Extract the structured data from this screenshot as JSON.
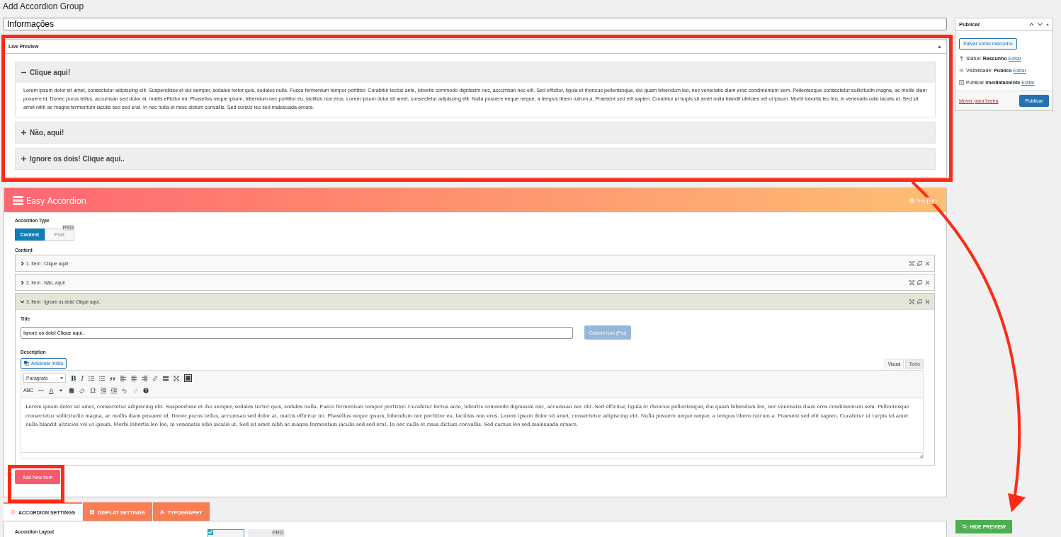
{
  "page_title": "Add Accordion Group",
  "title_field": {
    "value": "Informações"
  },
  "live_preview": {
    "title": "Live Preview",
    "items": [
      {
        "title": "Clique aqui!",
        "expanded": true,
        "body": "Lorem ipsum dolor sit amet, consectetur adipiscing elit. Suspendisse et dui semper, sodales tortor quis, sodales nulla. Fusce fermentum tempor porttitor. Curabitur lectus ante, lobortis commodo dignissim nec, accumsan nec elit. Sed efficitur, ligula et rhoncus pellentesque, dui quam bibendum leo, nec venenatis diam eros condimentum sem. Pellentesque consectetur sollicitudin magna, ac mollis diam posuere id. Donec purus tellus, accumsan sed dolor at, mattis efficitur mi. Phasellus neque ipsum, bibendum nec porttitor eu, facilisis non eros. Lorem ipsum dolor sit amet, consectetur adipiscing elit. Nulla posuere neque neque, a tempus libero rutrum a. Praesent sed elit sapien. Curabitur ut turpis sit amet nulla blandit ultricies vel ut ipsum. Morbi lobortis leo leo, in venenatis odio iaculis ut. Sed sit amet nibh ac magna fermentum iaculis sed sed erat. In nec nulla et risus dictum convallis. Sed cursus leo sed malesuada ornare."
      },
      {
        "title": "Não, aqui!",
        "expanded": false
      },
      {
        "title": "Ignore os dois! Clique aqui..",
        "expanded": false
      }
    ]
  },
  "easy_accordion": {
    "title": "Easy Accordion",
    "support": "Support",
    "type_label": "Accordion Type",
    "type_options": [
      {
        "label": "Content",
        "selected": true
      },
      {
        "label": "Post",
        "selected": false,
        "badge": "PRO"
      }
    ],
    "content_label": "Content",
    "items": [
      {
        "label": "1. Item :  Clique aqui!",
        "expanded": false
      },
      {
        "label": "2. Item :  Não, aqui!",
        "expanded": false
      },
      {
        "label": "3. Item :  Ignore os dois! Clique aqui..",
        "expanded": true
      }
    ],
    "item_form": {
      "title_label": "Title",
      "title_value": "Ignore os dois! Clique aqui..",
      "custom_icon": "Custom Icon (Pro)",
      "description_label": "Description",
      "add_media": "Adicionar mídia",
      "editor_tabs": [
        {
          "label": "Visual",
          "selected": true
        },
        {
          "label": "Texto",
          "selected": false
        }
      ],
      "format_select": "Parágrafo",
      "glyphs": {
        "bold": "B",
        "italic": "I",
        "strike": "ABC",
        "forecolor": "A",
        "omega": "Ω"
      },
      "content": "Lorem ipsum dolor sit amet, consectetur adipiscing elit. Suspendisse et dui semper, sodales tortor quis, sodales nulla. Fusce fermentum tempor porttitor. Curabitur lectus ante, lobortis commodo dignissim nec, accumsan nec elit. Sed efficitur, ligula et rhoncus pellentesque, dui quam bibendum leo, nec venenatis diam eros condimentum sem. Pellentesque consectetur sollicitudin magna, ac mollis diam posuere id. Donec purus tellus, accumsan sed dolor at, mattis efficitur mi. Phasellus neque ipsum, bibendum nec porttitor eu, facilisis non eros. Lorem ipsum dolor sit amet, consectetur adipiscing elit. Nulla posuere neque neque, a tempus libero rutrum a. Praesent sed elit sapien. Curabitur ut turpis sit amet nulla blandit ultricies vel ut ipsum. Morbi lobortis leo leo, in venenatis odio iaculis ut. Sed sit amet nibh ac magna fermentum iaculis sed sed erat. In nec nulla et risus dictum convallis. Sed cursus leo sed malesuada ornare."
    },
    "add_button": "Add New Item"
  },
  "settings_tabs": [
    {
      "label": "ACCORDION SETTINGS",
      "selected": true
    },
    {
      "label": "DISPLAY SETTINGS",
      "selected": false
    },
    {
      "label": "TYPOGRAPHY",
      "selected": false
    }
  ],
  "settings": {
    "layout_label": "Accordion Layout",
    "layout_options": [
      {
        "selected": true
      },
      {
        "selected": false,
        "badge": "PRO"
      }
    ]
  },
  "hide_preview": "HIDE PREVIEW",
  "publish_box": {
    "title": "Publicar",
    "save_draft": "Salvar como rascunho",
    "rows": [
      {
        "kind": "pin",
        "label": "Status:",
        "value": "Rascunho",
        "link": "Editar"
      },
      {
        "kind": "eye",
        "label": "Visibilidade:",
        "value": "Público",
        "link": "Editar"
      },
      {
        "kind": "calendar",
        "label": "Publicar",
        "value": "imediatamente",
        "link": "Editar"
      }
    ],
    "trash": "Mover para lixeira",
    "publish": "Publicar"
  }
}
